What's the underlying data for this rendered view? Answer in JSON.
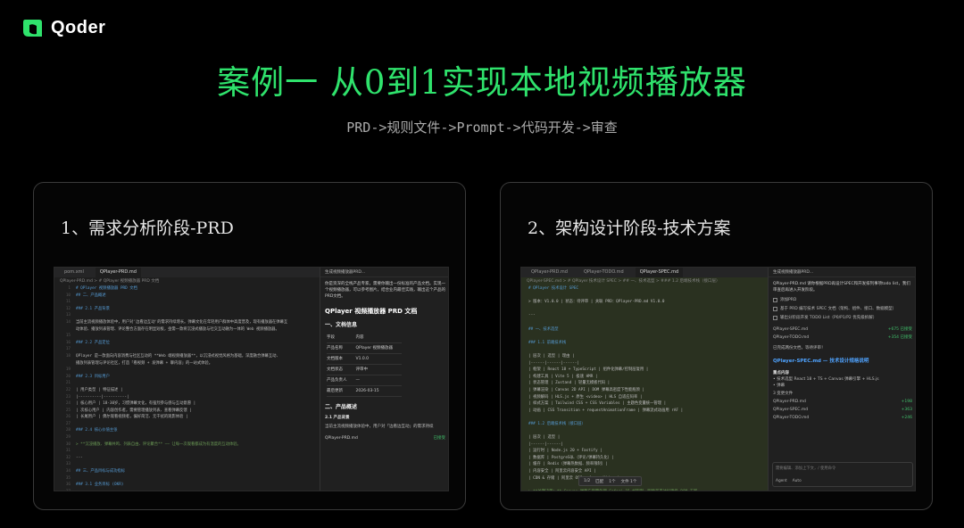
{
  "brand": {
    "name": "Qoder",
    "color": "#2fe26c"
  },
  "title": "案例一  从0到1实现本地视频播放器",
  "subtitle": "PRD->规则文件->Prompt->代码开发->审查",
  "panel_left": {
    "title": "1、需求分析阶段-PRD",
    "tabs": [
      "pom.xml",
      "QPlayer-PRD.md"
    ],
    "breadcrumb": "QPlayer-PRD.md > # QPlayer 视频播放器 PRD 文档",
    "code": [
      {
        "n": "1",
        "t": "# QPlayer 视频播放器 PRD 文档",
        "k": "h"
      },
      {
        "n": "10",
        "t": "## 二、产品概述",
        "k": "h"
      },
      {
        "n": "11",
        "t": "",
        "k": ""
      },
      {
        "n": "12",
        "t": "### 2.1 产品背景",
        "k": "h"
      },
      {
        "n": "13",
        "t": "",
        "k": ""
      },
      {
        "n": "14",
        "t": "当前主流视频播放体验中，用户对'边看边互动'的需求持续增长。弹幕文化在年轻用户群体中高度普及，现有播放器在弹幕互",
        "k": ""
      },
      {
        "n": "",
        "t": "动体验、播放列表管理、评论整合方面存在明显短板，亟需一款将沉浸式播放与社交互动融为一体的 Web 视频播放器。",
        "k": ""
      },
      {
        "n": "15",
        "t": "",
        "k": ""
      },
      {
        "n": "16",
        "t": "### 2.2 产品定位",
        "k": "h"
      },
      {
        "n": "17",
        "t": "",
        "k": ""
      },
      {
        "n": "18",
        "t": "QPlayer 是一款面向内容消费与社区互动的 **Web 端视频播放器**，以沉浸式视觉风格为基础，深度融合弹幕互动、",
        "k": ""
      },
      {
        "n": "",
        "t": "播放列表管理与评论社区，打造「看视频 + 发弹幕 + 聊内容」的一站式体验。",
        "k": ""
      },
      {
        "n": "19",
        "t": "",
        "k": ""
      },
      {
        "n": "20",
        "t": "### 2.3 目标用户",
        "k": "h"
      },
      {
        "n": "21",
        "t": "",
        "k": ""
      },
      {
        "n": "22",
        "t": "| 用户类型 | 特征描述 |",
        "k": ""
      },
      {
        "n": "23",
        "t": "|----------|----------|",
        "k": ""
      },
      {
        "n": "24",
        "t": "| 核心用户 | 18-30岁，习惯弹幕文化，有强烈参与感与互动意愿 |",
        "k": ""
      },
      {
        "n": "25",
        "t": "| 次核心用户 | 内容创作者，需要管理播放列表、查看弹幕反馈 |",
        "k": ""
      },
      {
        "n": "26",
        "t": "| 长尾用户 | 偶尔观看视频者，偏好简洁、无干扰的观影体验 |",
        "k": ""
      },
      {
        "n": "27",
        "t": "",
        "k": ""
      },
      {
        "n": "28",
        "t": "### 2.4 核心价值主张",
        "k": "h"
      },
      {
        "n": "29",
        "t": "",
        "k": ""
      },
      {
        "n": "30",
        "t": "> **沉浸播放、弹幕共鸣、列表自由、评论聚合** —— 让每一次观看都成为有温度的互动体验。",
        "k": "g"
      },
      {
        "n": "31",
        "t": "",
        "k": ""
      },
      {
        "n": "32",
        "t": "---",
        "k": ""
      },
      {
        "n": "33",
        "t": "",
        "k": ""
      },
      {
        "n": "34",
        "t": "## 三、产品目标与成功指标",
        "k": "h"
      },
      {
        "n": "35",
        "t": "",
        "k": ""
      },
      {
        "n": "36",
        "t": "### 3.1 业务目标 (OKR)",
        "k": "h"
      },
      {
        "n": "37",
        "t": "",
        "k": ""
      },
      {
        "n": "38",
        "t": "**O1：成为用户首选的 Web 端互动视频播放器**",
        "k": "o"
      }
    ],
    "chat": {
      "head": "生成视频播放器PRD...",
      "intro": "你是资深的全栈产品专家，需要你输出一份标准的产品文档。实现一个视频播放器，可以参考图片，结合业内最佳实践，输出这个产品的PRD文档。",
      "doc_title": "QPlayer 视频播放器 PRD 文档",
      "sec1": "一、文档信息",
      "table_head": [
        "字段",
        "内容"
      ],
      "table": [
        [
          "产品名称",
          "QPlayer 视频播放器"
        ],
        [
          "文档版本",
          "V1.0.0"
        ],
        [
          "文档状态",
          "评审中"
        ],
        [
          "产品负责人",
          "—"
        ],
        [
          "最后更新",
          "2026-03-15"
        ]
      ],
      "sec2": "二、产品概述",
      "sec21": "2.1 产品背景",
      "para": "当前主流视频播放体验中，用户对「边看边互动」的需求持续",
      "file": "QPlayer-PRD.md",
      "file_status": "已接受"
    }
  },
  "panel_right": {
    "title": "2、架构设计阶段-技术方案",
    "tabs": [
      "QPlayer-PRD.md",
      "QPlayer-TODO.md",
      "QPlayer-SPEC.md"
    ],
    "breadcrumb": "QPlayer-SPEC.md > # QPlayer 技术设计 SPEC > ## 一、技术选型 > ### 1.2 后端技术栈（接口层）",
    "code": [
      {
        "t": "# QPlayer 技术设计 SPEC",
        "k": "h"
      },
      {
        "t": "",
        "k": ""
      },
      {
        "t": "> 版本：V1.0.0 | 状态：待评审 | 关联 PRD：QPlayer-PRD.md V1.0.0",
        "k": ""
      },
      {
        "t": "",
        "k": ""
      },
      {
        "t": "---",
        "k": ""
      },
      {
        "t": "",
        "k": ""
      },
      {
        "t": "## 一、技术选型",
        "k": "h"
      },
      {
        "t": "",
        "k": ""
      },
      {
        "t": "### 1.1 前端技术栈",
        "k": "h"
      },
      {
        "t": "",
        "k": ""
      },
      {
        "t": "| 层次 | 选型 | 理由 |",
        "k": ""
      },
      {
        "t": "|------|------|------|",
        "k": ""
      },
      {
        "t": "| 框架 | React 18 + TypeScript | 组件化弹幕/控制层复用 |",
        "k": ""
      },
      {
        "t": "| 构建工具 | Vite 5 | 极速 HMR |",
        "k": ""
      },
      {
        "t": "| 状态管理 | Zustand | 轻量无模板代码 |",
        "k": ""
      },
      {
        "t": "| 弹幕渲染 | Canvas 2D API | DOM 弹幕高密度下性能瓶颈 |",
        "k": ""
      },
      {
        "t": "| 视频解码 | HLS.js + 原生 <video> | HLS 自适应码率 |",
        "k": ""
      },
      {
        "t": "| 样式方案 | Tailwind CSS + CSS Variables | 主题色变量统一管理 |",
        "k": ""
      },
      {
        "t": "| 动画 | CSS Transition + requestAnimationFrame | 弹幕流式动画用 rAF |",
        "k": ""
      },
      {
        "t": "",
        "k": ""
      },
      {
        "t": "### 1.2 后端技术栈（接口层）",
        "k": "h"
      },
      {
        "t": "",
        "k": ""
      },
      {
        "t": "| 层次 | 选型 |",
        "k": ""
      },
      {
        "t": "|------|------|",
        "k": ""
      },
      {
        "t": "| 运行时 | Node.js 20 + Fastify |",
        "k": ""
      },
      {
        "t": "| 数据库 | PostgreSQL（评论/弹幕持久化）|",
        "k": ""
      },
      {
        "t": "| 缓存 | Redis（弹幕热数据、频率限制）|",
        "k": ""
      },
      {
        "t": "| 内容安全 | 阿里云内容安全 API |",
        "k": ""
      },
      {
        "t": "| CDN & 存储 | 阿里云 OSS + AccessVideo |",
        "k": ""
      },
      {
        "t": "",
        "k": ""
      },
      {
        "t": "> **关键决策：** Canvas 弹幕方案需处理 Safari 15 帧限制，明确首不达标降级 DOM 方案。",
        "k": "g"
      },
      {
        "t": "",
        "k": ""
      },
      {
        "t": "---",
        "k": ""
      },
      {
        "t": "",
        "k": ""
      },
      {
        "t": "## 二、整体架构",
        "k": "h"
      }
    ],
    "findbar": [
      "1/2",
      "匹配",
      "1个",
      "文件 1个"
    ],
    "chat": {
      "head": "生成视频播放器PRD...",
      "intro": "QPlayer-PRD.md 请你根据PRD再设计SPEC和开发排列事项todo list，我们审查后再进入开发阶段。",
      "checks": [
        "添加PRD",
        "基于 PRD 编写技术 SPEC 文档（架构、组件、接口、数据模型）",
        "输出分阶段开发 TODO List（P0/P1/P2 优先级拆解）"
      ],
      "files": [
        {
          "name": "QPlayer-SPEC.md",
          "delta": "+675",
          "status": "已接受"
        },
        {
          "name": "QPlayer-TODO.md",
          "delta": "+354",
          "status": "已接受"
        }
      ],
      "done": "已完成两份文档，等待评审！",
      "link": "QPlayer-SPEC.md — 技术设计规格说明",
      "key": "重点内容",
      "bullet": "• 技术选型 React 18 + TS + Canvas 弹幕引擎 + HLS.js",
      "bullet2": "• 弹幕",
      "changed": "3 变更文件",
      "changed_files": [
        {
          "name": "QPlayer-PRD.md",
          "delta": "+198"
        },
        {
          "name": "QPlayer-SPEC.md",
          "delta": "+363"
        },
        {
          "name": "QPlayer-TODO.md",
          "delta": "+246"
        }
      ],
      "input": "需要编辑、添加上下文，/ 使用命令",
      "mode": "Agent",
      "model": "Auto"
    }
  }
}
